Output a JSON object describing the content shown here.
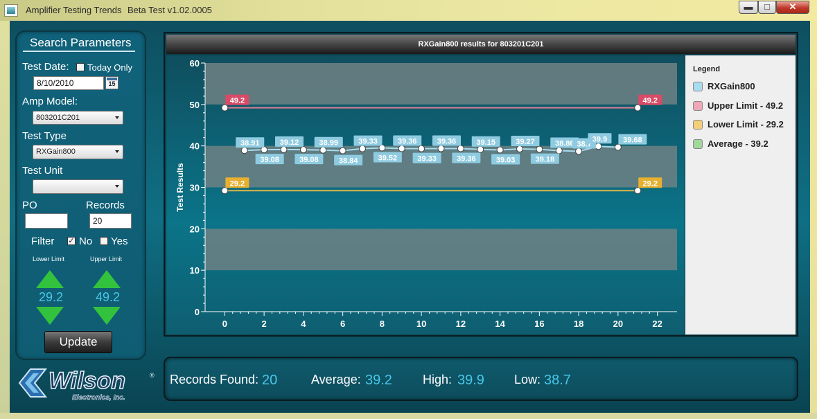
{
  "window": {
    "title": "Amplifier Testing Trends",
    "version": "Beta Test v1.02.0005",
    "min_glyph": "▬",
    "max_glyph": "□",
    "close_glyph": "✕"
  },
  "search": {
    "title": "Search Parameters",
    "test_date_label": "Test Date:",
    "today_only_label": "Today Only",
    "today_only_checked": false,
    "test_date_value": "8/10/2010",
    "calendar_day": "15",
    "amp_model_label": "Amp Model:",
    "amp_model_value": "803201C201",
    "test_type_label": "Test Type",
    "test_type_value": "RXGain800",
    "test_unit_label": "Test Unit",
    "test_unit_value": "",
    "po_label": "PO",
    "po_value": "",
    "records_label": "Records",
    "records_value": "20",
    "filter_label": "Filter",
    "filter_no_label": "No",
    "filter_no_checked": true,
    "filter_yes_label": "Yes",
    "filter_yes_checked": false,
    "lower_limit_label": "Lower Limit",
    "upper_limit_label": "Upper Limit",
    "lower_limit_value": "29.2",
    "upper_limit_value": "49.2",
    "update_label": "Update"
  },
  "logo": {
    "name": "Wilson",
    "sub": "Electronics, Inc.",
    "mark": "®"
  },
  "stats": {
    "records_found_label": "Records Found:",
    "records_found_value": "20",
    "average_label": "Average:",
    "average_value": "39.2",
    "high_label": "High:",
    "high_value": "39.9",
    "low_label": "Low:",
    "low_value": "38.7"
  },
  "legend": {
    "title": "Legend",
    "items": [
      {
        "label": "RXGain800",
        "color": "#a9dcef"
      },
      {
        "label": "Upper Limit - 49.2",
        "color": "#f0a7b6"
      },
      {
        "label": "Lower Limit - 29.2",
        "color": "#f4cf7a"
      },
      {
        "label": "Average - 39.2",
        "color": "#9fd89a"
      }
    ]
  },
  "chart_data": {
    "type": "line",
    "title": "RXGain800 results for 803201C201",
    "xlabel": "",
    "ylabel": "Test Results",
    "xlim": [
      -1,
      23
    ],
    "ylim": [
      0,
      60
    ],
    "x_ticks": [
      0,
      2,
      4,
      6,
      8,
      10,
      12,
      14,
      16,
      18,
      20,
      22
    ],
    "y_ticks": [
      0,
      10,
      20,
      30,
      40,
      50,
      60
    ],
    "series": [
      {
        "name": "RXGain800",
        "color": "#a9dcef",
        "x": [
          1,
          2,
          3,
          4,
          5,
          6,
          7,
          8,
          9,
          10,
          11,
          12,
          13,
          14,
          15,
          16,
          17,
          18,
          19,
          20
        ],
        "values": [
          38.91,
          39.08,
          39.12,
          39.08,
          38.99,
          38.84,
          39.33,
          39.52,
          39.36,
          39.33,
          39.36,
          39.36,
          39.15,
          39.03,
          39.27,
          39.18,
          38.86,
          38.7,
          39.9,
          39.68
        ],
        "labels": [
          "38.91",
          "39.08",
          "39.12",
          "39.08",
          "38.99",
          "38.84",
          "39.33",
          "39.52",
          "39.36",
          "39.33",
          "39.36",
          "39.36",
          "39.15",
          "39.03",
          "39.27",
          "39.18",
          "38.86",
          "38.7",
          "39.9",
          "39.68"
        ],
        "label_above": [
          true,
          false,
          true,
          false,
          true,
          false,
          true,
          false,
          true,
          false,
          true,
          false,
          true,
          false,
          true,
          false,
          true,
          true,
          true,
          true
        ]
      },
      {
        "name": "Upper Limit",
        "color": "#e07b8e",
        "label_color": "#d94b66",
        "x": [
          0,
          21
        ],
        "values": [
          49.2,
          49.2
        ],
        "labels": [
          "49.2",
          "49.2"
        ]
      },
      {
        "name": "Lower Limit",
        "color": "#e0b44a",
        "label_color": "#e8b030",
        "x": [
          0,
          21
        ],
        "values": [
          29.2,
          29.2
        ],
        "labels": [
          "29.2",
          "29.2"
        ]
      }
    ],
    "bands": [
      [
        10,
        20
      ],
      [
        30,
        40
      ],
      [
        50,
        60
      ]
    ],
    "grid": false,
    "legend": "right"
  }
}
